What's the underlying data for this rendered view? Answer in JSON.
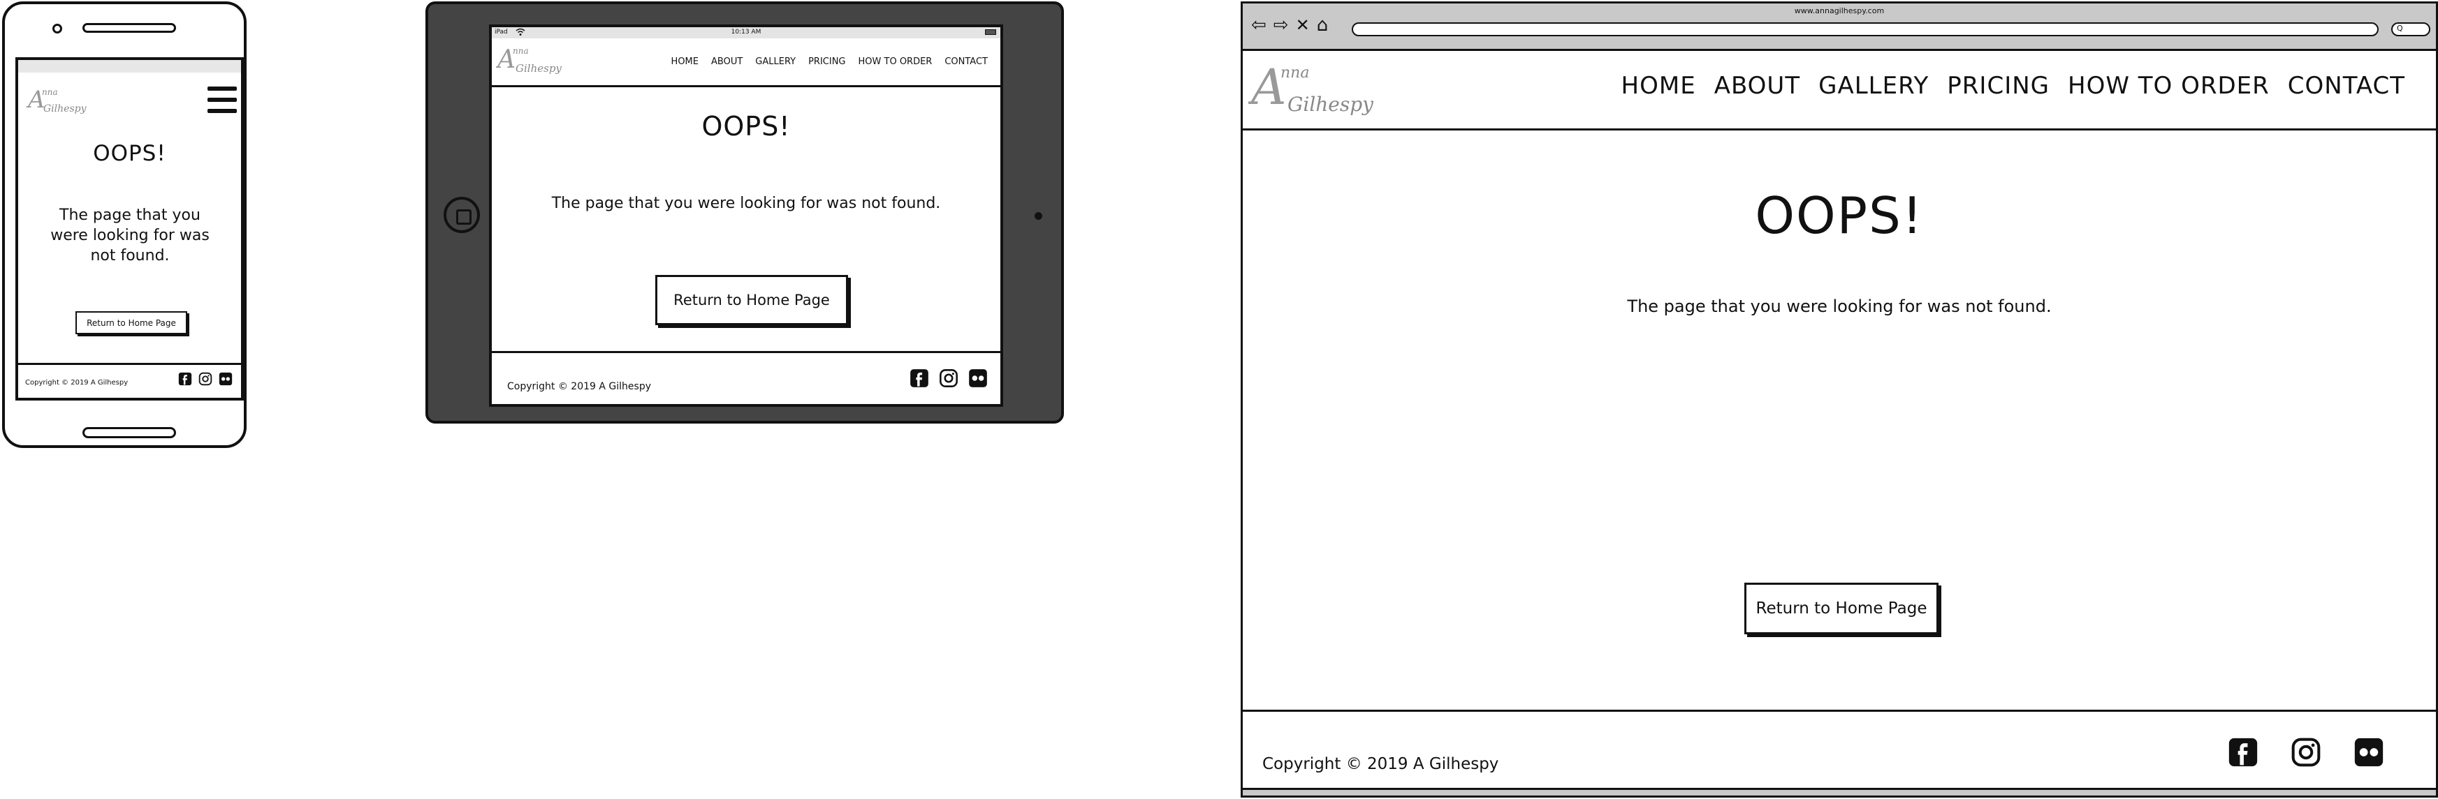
{
  "phone": {
    "page_title": "OOPS!",
    "message": "The page that you were looking for was not found.",
    "button_label": "Return to Home Page",
    "copyright": "Copyright © 2019 A Gilhespy",
    "socials": [
      "facebook-icon",
      "instagram-icon",
      "flickr-icon"
    ]
  },
  "tablet": {
    "status": {
      "device": "iPad",
      "time": "10:13 AM"
    },
    "logo": {
      "line1": "Anna",
      "line2": "Gilhespy"
    },
    "nav": [
      "HOME",
      "ABOUT",
      "GALLERY",
      "PRICING",
      "HOW TO ORDER",
      "CONTACT"
    ],
    "page_title": "OOPS!",
    "message": "The page that you were looking for was not found.",
    "button_label": "Return to Home Page",
    "copyright": "Copyright © 2019 A Gilhespy"
  },
  "desktop": {
    "url": "www.annagilhespy.com",
    "search_placeholder": "Q",
    "logo": {
      "line1": "Anna",
      "line2": "Gilhespy"
    },
    "nav": [
      "HOME",
      "ABOUT",
      "GALLERY",
      "PRICING",
      "HOW TO ORDER",
      "CONTACT"
    ],
    "page_title": "OOPS!",
    "message": "The page that you were looking for was not found.",
    "button_label": "Return to Home Page",
    "copyright": "Copyright © 2019 A Gilhespy"
  }
}
